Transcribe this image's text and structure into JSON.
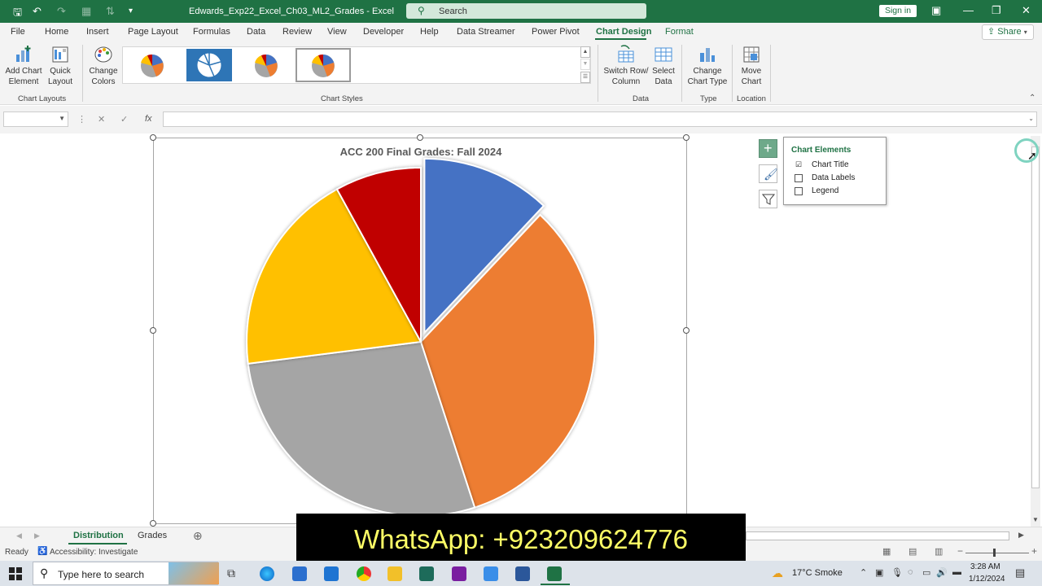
{
  "titlebar": {
    "doc_title": "Edwards_Exp22_Excel_Ch03_ML2_Grades  -  Excel",
    "search_label": "Search",
    "signin_label": "Sign in"
  },
  "tabs": [
    "File",
    "Home",
    "Insert",
    "Page Layout",
    "Formulas",
    "Data",
    "Review",
    "View",
    "Developer",
    "Help",
    "Data Streamer",
    "Power Pivot",
    "Chart Design",
    "Format"
  ],
  "active_tab": "Chart Design",
  "share_label": "Share",
  "ribbon": {
    "add_chart_element": "Add Chart\nElement",
    "quick_layout": "Quick\nLayout",
    "change_colors": "Change\nColors",
    "switch_row_col": "Switch Row/\nColumn",
    "select_data": "Select\nData",
    "change_chart_type": "Change\nChart Type",
    "move_chart": "Move\nChart",
    "groups": {
      "chart_layouts": "Chart Layouts",
      "chart_styles": "Chart Styles",
      "data": "Data",
      "type": "Type",
      "location": "Location"
    }
  },
  "formula_bar": {
    "fx_label": "fx",
    "name_box": "",
    "formula": ""
  },
  "chart": {
    "title": "ACC 200 Final Grades: Fall 2024",
    "colors": [
      "#4472c4",
      "#ed7d31",
      "#a5a5a5",
      "#ffc000",
      "#c00000"
    ]
  },
  "chart_data": {
    "type": "pie",
    "title": "ACC 200 Final Grades: Fall 2024",
    "values": [
      12,
      33,
      28,
      19,
      8
    ],
    "exploded_slice": 0,
    "legend": false,
    "data_labels": false
  },
  "chart_elements": {
    "heading": "Chart Elements",
    "items": [
      {
        "label": "Chart Title",
        "checked": "☑"
      },
      {
        "label": "Data Labels",
        "checked": ""
      },
      {
        "label": "Legend",
        "checked": ""
      }
    ]
  },
  "sheet_tabs": [
    "Distribution",
    "Grades"
  ],
  "active_sheet": "Distribution",
  "status": {
    "ready": "Ready",
    "accessibility": "Accessibility: Investigate"
  },
  "overlay": {
    "text": "WhatsApp: +923209624776"
  },
  "taskbar": {
    "search_placeholder": "Type here to search",
    "weather": "17°C  Smoke",
    "time": "3:28 AM",
    "date": "1/12/2024"
  }
}
